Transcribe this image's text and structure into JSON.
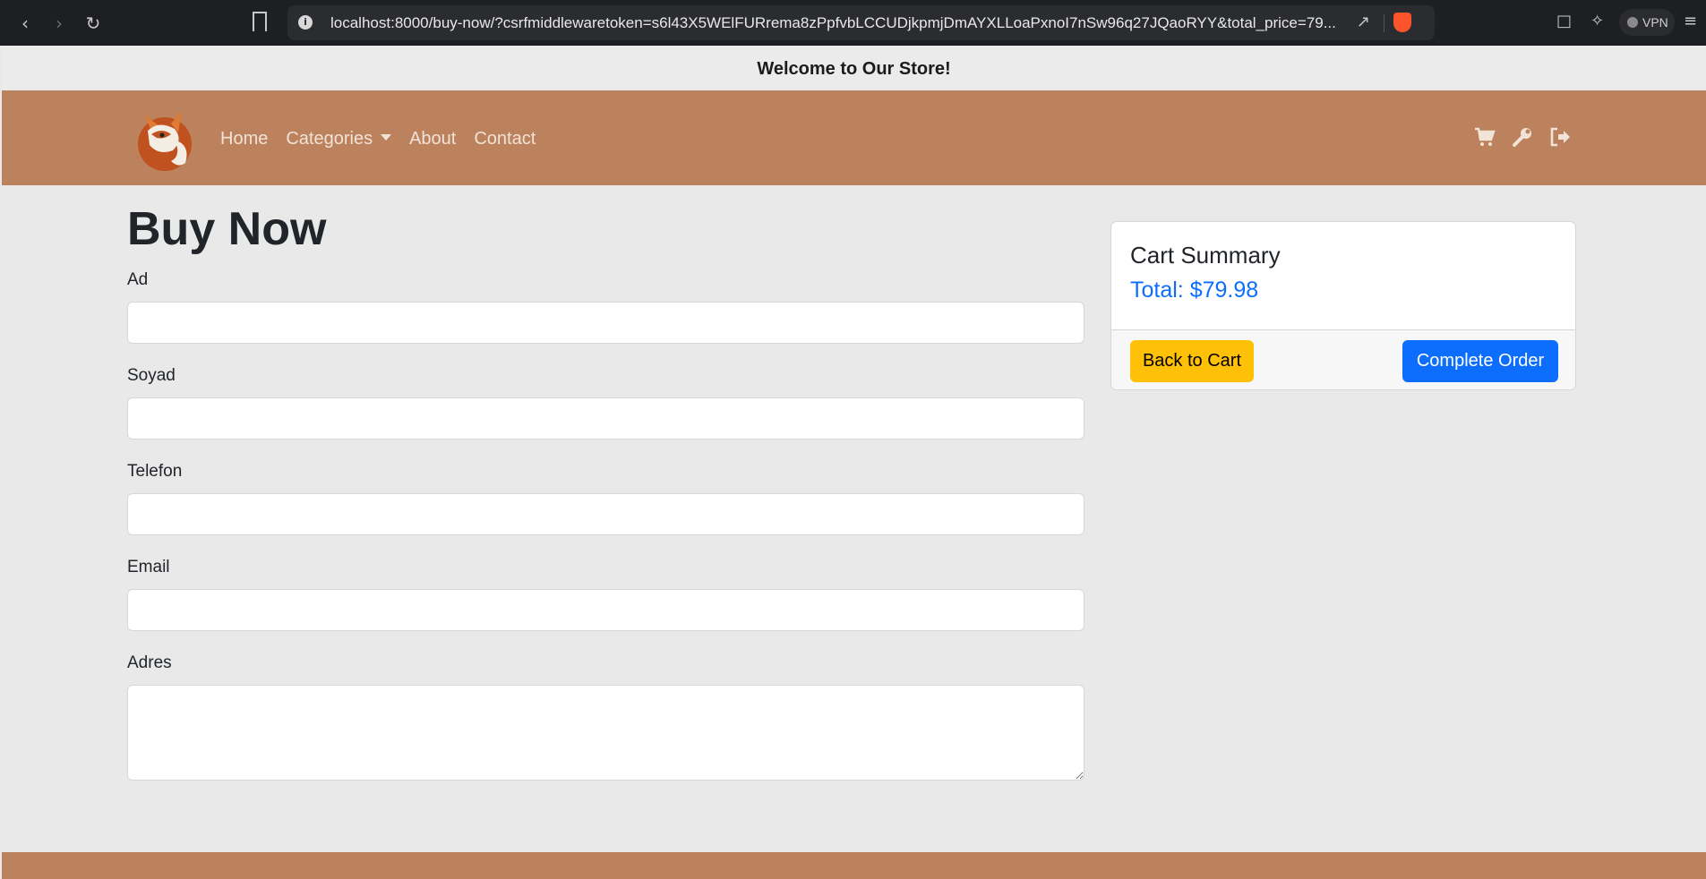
{
  "browser": {
    "url": "localhost:8000/buy-now/?csrfmiddlewaretoken=s6l43X5WElFURrema8zPpfvbLCCUDjkpmjDmAYXLLoaPxnoI7nSw96q27JQaoRYY&total_price=79...",
    "vpn_label": "VPN"
  },
  "announcement": "Welcome to Our Store!",
  "nav": {
    "links": [
      "Home",
      "Categories",
      "About",
      "Contact"
    ],
    "icons": [
      "cart-icon",
      "wrench-icon",
      "logout-icon"
    ]
  },
  "page": {
    "title": "Buy Now",
    "fields": [
      {
        "label": "Ad",
        "value": ""
      },
      {
        "label": "Soyad",
        "value": ""
      },
      {
        "label": "Telefon",
        "value": ""
      },
      {
        "label": "Email",
        "value": ""
      },
      {
        "label": "Adres",
        "value": ""
      }
    ]
  },
  "cart": {
    "title": "Cart Summary",
    "total": "Total: $79.98",
    "back_label": "Back to Cart",
    "complete_label": "Complete Order"
  },
  "colors": {
    "brand": "#bb825d",
    "primary": "#0d6efd",
    "warning": "#ffc107"
  }
}
